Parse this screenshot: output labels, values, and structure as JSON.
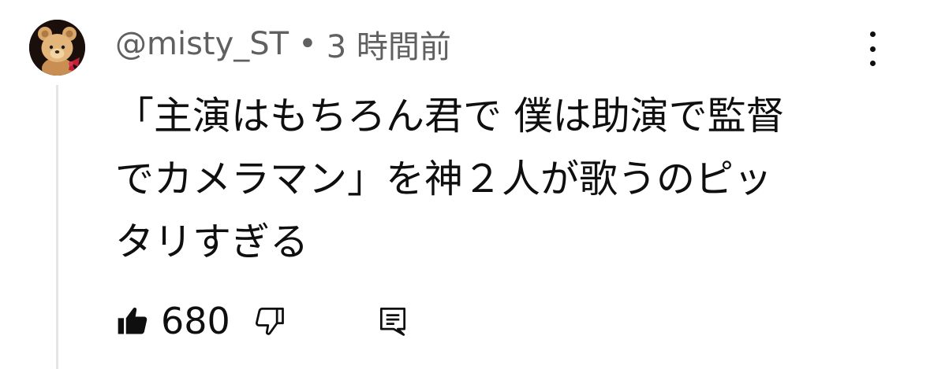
{
  "comment": {
    "author": "@misty_ST",
    "separator": "•",
    "timestamp": "3 時間前",
    "text": "「主演はもちろん君で 僕は助演で監督\nでカメラマン」を神２人が歌うのピッ\nタリすぎる",
    "like_count": "680"
  },
  "icons": {
    "avatar": "teddy-bear-avatar",
    "more": "more-vertical-icon",
    "like": "thumbs-up-filled-icon",
    "dislike": "thumbs-down-outline-icon",
    "reply": "comment-reply-icon"
  },
  "colors": {
    "text": "#0f0f0f",
    "secondary_text": "#606060",
    "thread_line": "#e5e5e5",
    "background": "#ffffff"
  }
}
